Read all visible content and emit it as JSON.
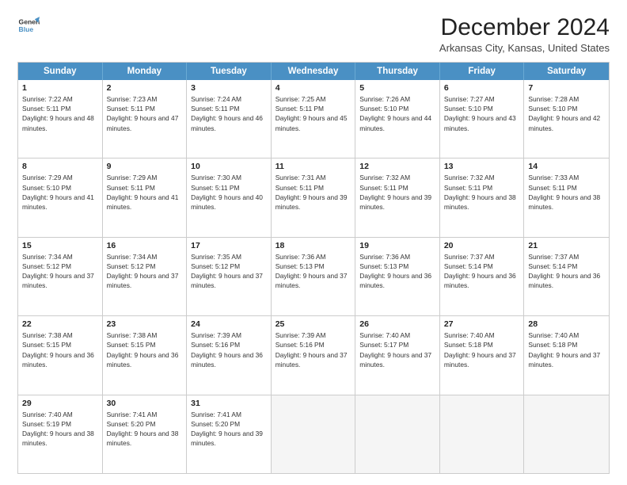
{
  "logo": {
    "line1": "General",
    "line2": "Blue"
  },
  "title": "December 2024",
  "subtitle": "Arkansas City, Kansas, United States",
  "header": {
    "days": [
      "Sunday",
      "Monday",
      "Tuesday",
      "Wednesday",
      "Thursday",
      "Friday",
      "Saturday"
    ]
  },
  "weeks": [
    [
      {
        "day": "1",
        "info": "Sunrise: 7:22 AM\nSunset: 5:11 PM\nDaylight: 9 hours and 48 minutes."
      },
      {
        "day": "2",
        "info": "Sunrise: 7:23 AM\nSunset: 5:11 PM\nDaylight: 9 hours and 47 minutes."
      },
      {
        "day": "3",
        "info": "Sunrise: 7:24 AM\nSunset: 5:11 PM\nDaylight: 9 hours and 46 minutes."
      },
      {
        "day": "4",
        "info": "Sunrise: 7:25 AM\nSunset: 5:11 PM\nDaylight: 9 hours and 45 minutes."
      },
      {
        "day": "5",
        "info": "Sunrise: 7:26 AM\nSunset: 5:10 PM\nDaylight: 9 hours and 44 minutes."
      },
      {
        "day": "6",
        "info": "Sunrise: 7:27 AM\nSunset: 5:10 PM\nDaylight: 9 hours and 43 minutes."
      },
      {
        "day": "7",
        "info": "Sunrise: 7:28 AM\nSunset: 5:10 PM\nDaylight: 9 hours and 42 minutes."
      }
    ],
    [
      {
        "day": "8",
        "info": "Sunrise: 7:29 AM\nSunset: 5:10 PM\nDaylight: 9 hours and 41 minutes."
      },
      {
        "day": "9",
        "info": "Sunrise: 7:29 AM\nSunset: 5:11 PM\nDaylight: 9 hours and 41 minutes."
      },
      {
        "day": "10",
        "info": "Sunrise: 7:30 AM\nSunset: 5:11 PM\nDaylight: 9 hours and 40 minutes."
      },
      {
        "day": "11",
        "info": "Sunrise: 7:31 AM\nSunset: 5:11 PM\nDaylight: 9 hours and 39 minutes."
      },
      {
        "day": "12",
        "info": "Sunrise: 7:32 AM\nSunset: 5:11 PM\nDaylight: 9 hours and 39 minutes."
      },
      {
        "day": "13",
        "info": "Sunrise: 7:32 AM\nSunset: 5:11 PM\nDaylight: 9 hours and 38 minutes."
      },
      {
        "day": "14",
        "info": "Sunrise: 7:33 AM\nSunset: 5:11 PM\nDaylight: 9 hours and 38 minutes."
      }
    ],
    [
      {
        "day": "15",
        "info": "Sunrise: 7:34 AM\nSunset: 5:12 PM\nDaylight: 9 hours and 37 minutes."
      },
      {
        "day": "16",
        "info": "Sunrise: 7:34 AM\nSunset: 5:12 PM\nDaylight: 9 hours and 37 minutes."
      },
      {
        "day": "17",
        "info": "Sunrise: 7:35 AM\nSunset: 5:12 PM\nDaylight: 9 hours and 37 minutes."
      },
      {
        "day": "18",
        "info": "Sunrise: 7:36 AM\nSunset: 5:13 PM\nDaylight: 9 hours and 37 minutes."
      },
      {
        "day": "19",
        "info": "Sunrise: 7:36 AM\nSunset: 5:13 PM\nDaylight: 9 hours and 36 minutes."
      },
      {
        "day": "20",
        "info": "Sunrise: 7:37 AM\nSunset: 5:14 PM\nDaylight: 9 hours and 36 minutes."
      },
      {
        "day": "21",
        "info": "Sunrise: 7:37 AM\nSunset: 5:14 PM\nDaylight: 9 hours and 36 minutes."
      }
    ],
    [
      {
        "day": "22",
        "info": "Sunrise: 7:38 AM\nSunset: 5:15 PM\nDaylight: 9 hours and 36 minutes."
      },
      {
        "day": "23",
        "info": "Sunrise: 7:38 AM\nSunset: 5:15 PM\nDaylight: 9 hours and 36 minutes."
      },
      {
        "day": "24",
        "info": "Sunrise: 7:39 AM\nSunset: 5:16 PM\nDaylight: 9 hours and 36 minutes."
      },
      {
        "day": "25",
        "info": "Sunrise: 7:39 AM\nSunset: 5:16 PM\nDaylight: 9 hours and 37 minutes."
      },
      {
        "day": "26",
        "info": "Sunrise: 7:40 AM\nSunset: 5:17 PM\nDaylight: 9 hours and 37 minutes."
      },
      {
        "day": "27",
        "info": "Sunrise: 7:40 AM\nSunset: 5:18 PM\nDaylight: 9 hours and 37 minutes."
      },
      {
        "day": "28",
        "info": "Sunrise: 7:40 AM\nSunset: 5:18 PM\nDaylight: 9 hours and 37 minutes."
      }
    ],
    [
      {
        "day": "29",
        "info": "Sunrise: 7:40 AM\nSunset: 5:19 PM\nDaylight: 9 hours and 38 minutes."
      },
      {
        "day": "30",
        "info": "Sunrise: 7:41 AM\nSunset: 5:20 PM\nDaylight: 9 hours and 38 minutes."
      },
      {
        "day": "31",
        "info": "Sunrise: 7:41 AM\nSunset: 5:20 PM\nDaylight: 9 hours and 39 minutes."
      },
      {
        "day": "",
        "info": ""
      },
      {
        "day": "",
        "info": ""
      },
      {
        "day": "",
        "info": ""
      },
      {
        "day": "",
        "info": ""
      }
    ]
  ]
}
